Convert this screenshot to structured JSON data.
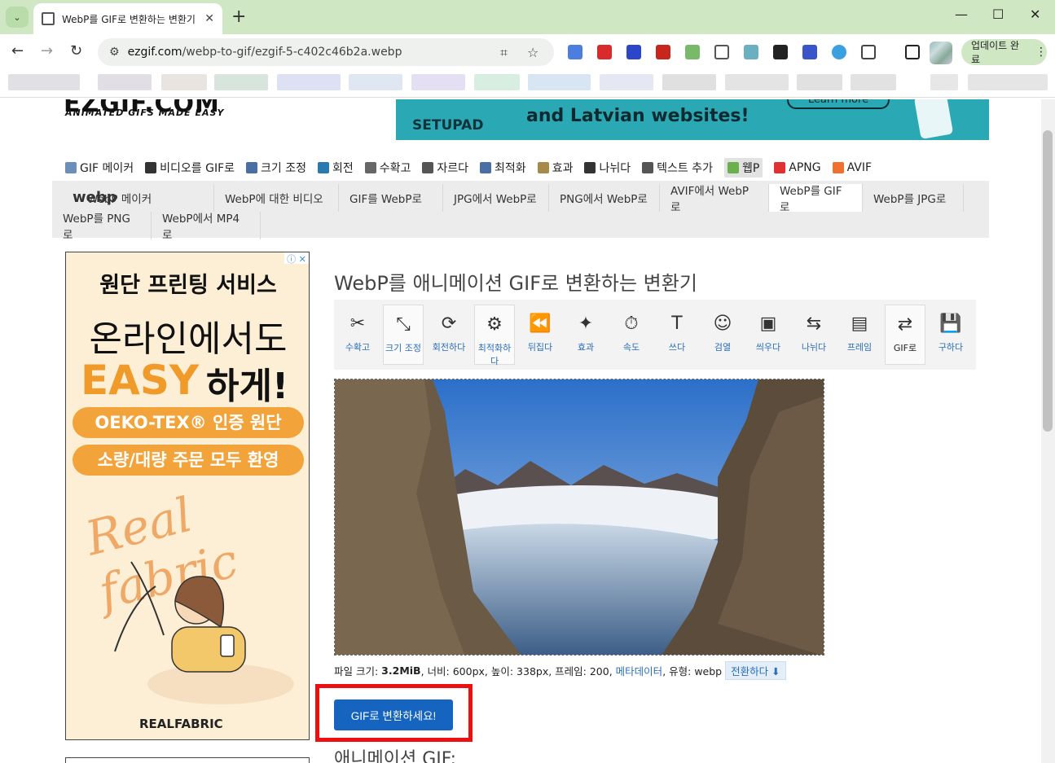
{
  "browser": {
    "tab_title": "WebP를 GIF로 변환하는 변환기",
    "tab_close": "✕",
    "new_tab": "+",
    "tab_menu": "⌄",
    "window": {
      "minimize": "—",
      "maximize": "☐",
      "close": "✕"
    },
    "nav": {
      "back": "←",
      "forward": "→",
      "reload": "↻"
    },
    "url_domain": "ezgif.com",
    "url_path": "/webp-to-gif/ezgif-5-c402c46b2a.webp",
    "update_button": "업데이트 완료",
    "menu": "⋮"
  },
  "site": {
    "logo": "EZGIF.COM",
    "logo_tagline": "ANIMATED GIFS MADE EASY",
    "top_ad": {
      "brand": "SETUPAD",
      "tagline": "and Latvian websites!",
      "cta": "Learn more"
    },
    "main_nav": [
      {
        "label": "GIF 메이커",
        "icon": "gif-maker-icon",
        "color": "#6b8fb8"
      },
      {
        "label": "비디오를 GIF로",
        "icon": "film-icon",
        "color": "#333333"
      },
      {
        "label": "크기 조정",
        "icon": "resize-icon",
        "color": "#4a6fa5"
      },
      {
        "label": "회전",
        "icon": "rotate-icon",
        "color": "#2a7ab0"
      },
      {
        "label": "수확고",
        "icon": "crop-icon",
        "color": "#666666"
      },
      {
        "label": "자르다",
        "icon": "cut-icon",
        "color": "#555555"
      },
      {
        "label": "최적화",
        "icon": "optimize-icon",
        "color": "#4a6fa5"
      },
      {
        "label": "효과",
        "icon": "effects-icon",
        "color": "#a58a4a"
      },
      {
        "label": "나뉘다",
        "icon": "split-icon",
        "color": "#333333"
      },
      {
        "label": "텍스트 추가",
        "icon": "text-icon",
        "color": "#555555"
      },
      {
        "label": "웹P",
        "icon": "webp-icon",
        "color": "#6ab04c"
      },
      {
        "label": "APNG",
        "icon": "apng-icon",
        "color": "#e03030"
      },
      {
        "label": "AVIF",
        "icon": "avif-icon",
        "color": "#f07030"
      }
    ],
    "sub_logo": "webp",
    "sub_nav_row1": [
      "WebP 메이커",
      "WebP에 대한 비디오",
      "GIF를 WebP로",
      "JPG에서 WebP로",
      "PNG에서 WebP로",
      "AVIF에서 WebP로",
      "WebP를 GIF로",
      "WebP를 JPG로"
    ],
    "sub_nav_row2": [
      "WebP를 PNG로",
      "WebP에서 MP4로"
    ],
    "side_ad": {
      "line1": "원단 프린팅 서비스",
      "line2": "온라인에서도",
      "line3a": "EASY",
      "line3b": "하게!",
      "pill1": "OEKO-TEX® 인증 원단",
      "pill2": "소량/대량 주문 모두 환영",
      "script": "Real fabric",
      "brand": "REALFABRIC",
      "adchoices": "ⓘ ✕"
    },
    "heading": "WebP를 애니메이션 GIF로 변환하는 변환기",
    "tools": [
      {
        "label": "수확고",
        "icon": "crop-tool-icon",
        "glyph": "✂"
      },
      {
        "label": "크기 조정",
        "icon": "resize-tool-icon",
        "glyph": "⤡"
      },
      {
        "label": "회전하다",
        "icon": "rotate-tool-icon",
        "glyph": "⟳"
      },
      {
        "label": "최적화하다",
        "icon": "optimize-tool-icon",
        "glyph": "⚙"
      },
      {
        "label": "뒤집다",
        "icon": "reverse-tool-icon",
        "glyph": "⏪"
      },
      {
        "label": "효과",
        "icon": "effects-tool-icon",
        "glyph": "✦"
      },
      {
        "label": "속도",
        "icon": "speed-tool-icon",
        "glyph": "⏱"
      },
      {
        "label": "쓰다",
        "icon": "write-tool-icon",
        "glyph": "T"
      },
      {
        "label": "검열",
        "icon": "censor-tool-icon",
        "glyph": "☺"
      },
      {
        "label": "씌우다",
        "icon": "overlay-tool-icon",
        "glyph": "▣"
      },
      {
        "label": "나뉘다",
        "icon": "split-tool-icon",
        "glyph": "⇆"
      },
      {
        "label": "프레임",
        "icon": "frames-tool-icon",
        "glyph": "▤"
      },
      {
        "label": "GIF로",
        "icon": "to-gif-tool-icon",
        "glyph": "⇄"
      },
      {
        "label": "구하다",
        "icon": "save-tool-icon",
        "glyph": "💾"
      }
    ],
    "file_info": {
      "size_label": "파일 크기:",
      "size_value": "3.2MiB",
      "rest": ", 너비: 600px, 높이: 338px, 프레임: 200,",
      "metadata": "메타데이터",
      "type": ", 유형: webp",
      "convert": "전환하다 ⬇"
    },
    "convert_button": "GIF로 변환하세요!",
    "output_heading": "애니메이션 GIF:"
  }
}
